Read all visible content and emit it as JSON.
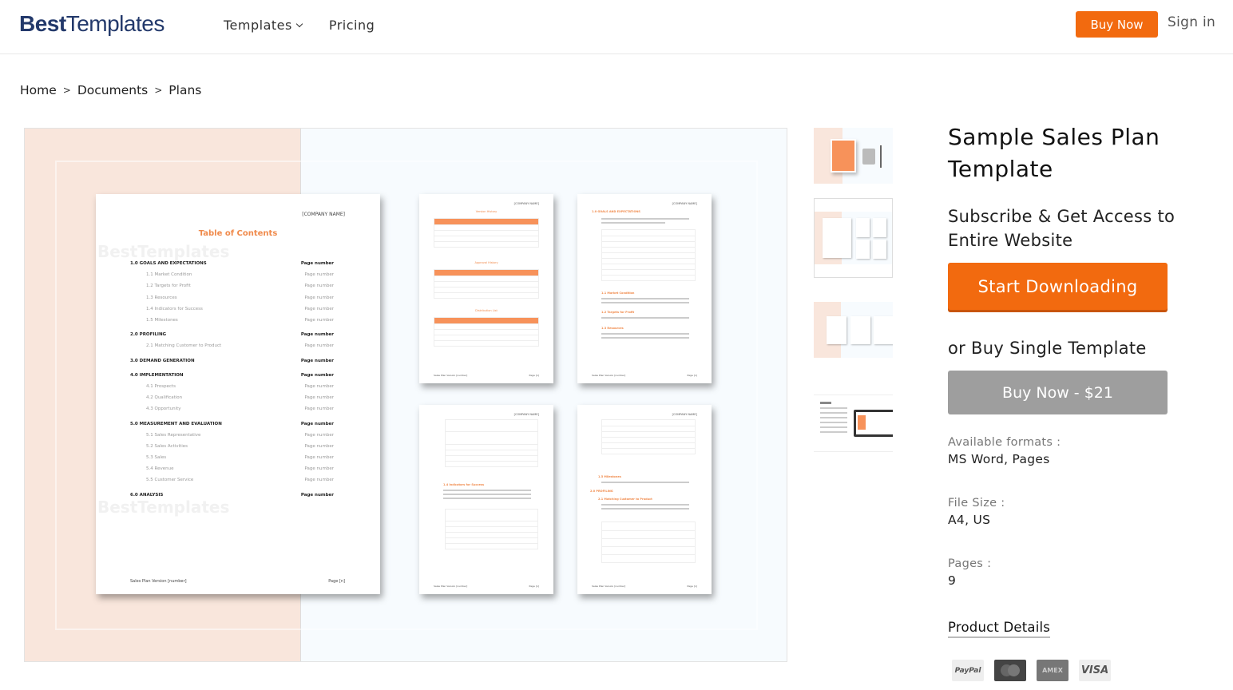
{
  "header": {
    "logo_bold": "Best",
    "logo_light": "Templates",
    "nav": [
      {
        "label": "Templates",
        "has_dropdown": true
      },
      {
        "label": "Pricing",
        "has_dropdown": false
      }
    ],
    "buy_now": "Buy Now",
    "sign_in": "Sign in"
  },
  "breadcrumb": {
    "items": [
      "Home",
      "Documents",
      "Plans"
    ],
    "separator": ">"
  },
  "preview": {
    "company": "[COMPANY NAME]",
    "toc_title": "Table of Contents",
    "watermark": "BestTemplates",
    "toc": [
      {
        "label": "1.0 GOALS AND EXPECTATIONS",
        "page": "Page number",
        "level": "main"
      },
      {
        "label": "1.1 Market Condition",
        "page": "Page number",
        "level": "sub"
      },
      {
        "label": "1.2 Targets for Profit",
        "page": "Page number",
        "level": "sub"
      },
      {
        "label": "1.3 Resources",
        "page": "Page number",
        "level": "sub"
      },
      {
        "label": "1.4 Indicators for Success",
        "page": "Page number",
        "level": "sub"
      },
      {
        "label": "1.5 Milestones",
        "page": "Page number",
        "level": "sub"
      },
      {
        "label": "2.0 PROFILING",
        "page": "Page number",
        "level": "main"
      },
      {
        "label": "2.1 Matching Customer to Product",
        "page": "Page number",
        "level": "sub"
      },
      {
        "label": "3.0 DEMAND GENERATION",
        "page": "Page number",
        "level": "main"
      },
      {
        "label": "4.0 IMPLEMENTATION",
        "page": "Page number",
        "level": "main"
      },
      {
        "label": "4.1 Prospects",
        "page": "Page number",
        "level": "sub"
      },
      {
        "label": "4.2 Qualification",
        "page": "Page number",
        "level": "sub"
      },
      {
        "label": "4.3 Opportunity",
        "page": "Page number",
        "level": "sub"
      },
      {
        "label": "5.0 MEASUREMENT AND EVALUATION",
        "page": "Page number",
        "level": "main"
      },
      {
        "label": "5.1 Sales Representative",
        "page": "Page number",
        "level": "sub"
      },
      {
        "label": "5.2 Sales Activities",
        "page": "Page number",
        "level": "sub"
      },
      {
        "label": "5.3 Sales",
        "page": "Page number",
        "level": "sub"
      },
      {
        "label": "5.4 Revenue",
        "page": "Page number",
        "level": "sub"
      },
      {
        "label": "5.5 Customer Service",
        "page": "Page number",
        "level": "sub"
      },
      {
        "label": "6.0 ANALYSIS",
        "page": "Page number",
        "level": "main"
      }
    ],
    "footer_left": "Sales Plan Version [number]",
    "footer_right": "Page [n]",
    "page2_titles": [
      "Version History",
      "Approval History",
      "Distribution List"
    ],
    "page3_heading": "1.0 GOALS AND EXPECTATIONS",
    "page3_subheads": [
      "1.1 Market Condition",
      "1.2 Targets for Profit",
      "1.3 Resources"
    ],
    "page4_subhead": "1.4 Indicators for Success",
    "page5_subheads": [
      "1.5 Milestones",
      "2.0 PROFILING",
      "2.1 Matching Customer to Product"
    ]
  },
  "thumbnails": [
    {
      "label": "cover-preview"
    },
    {
      "label": "pages-overview"
    },
    {
      "label": "inner-pages"
    },
    {
      "label": "features"
    }
  ],
  "product": {
    "title": "Sample Sales Plan Template",
    "subscribe_text": "Subscribe & Get Access to Entire Website",
    "start_downloading": "Start Downloading",
    "or_buy": "or Buy Single Template",
    "buy_single": "Buy Now - $21",
    "formats_label": "Available formats :",
    "formats_value": "MS Word, Pages",
    "filesize_label": "File Size :",
    "filesize_value": "A4, US",
    "pages_label": "Pages :",
    "pages_value": "9",
    "product_details": "Product Details",
    "payments": [
      "PayPal",
      "MasterCard",
      "AMEX",
      "VISA"
    ]
  }
}
